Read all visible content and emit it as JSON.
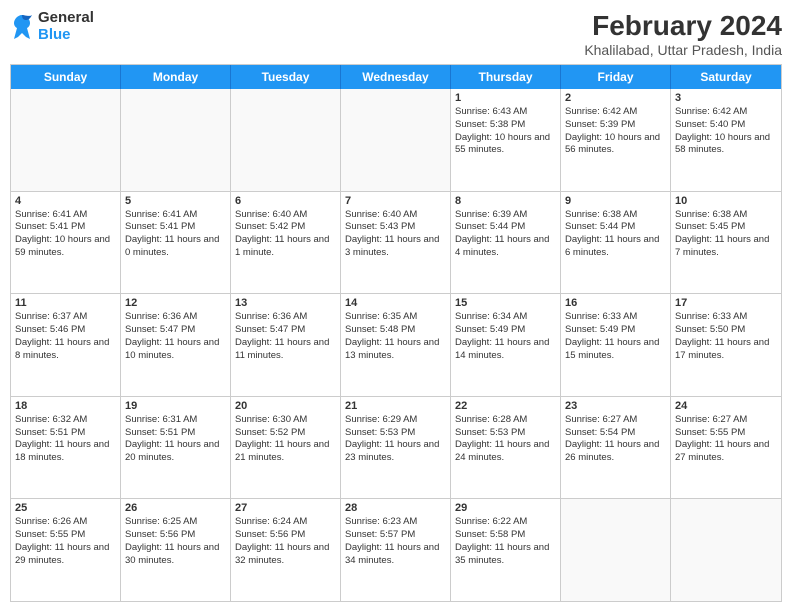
{
  "header": {
    "logo": {
      "general": "General",
      "blue": "Blue"
    },
    "month_year": "February 2024",
    "location": "Khalilabad, Uttar Pradesh, India"
  },
  "weekdays": [
    "Sunday",
    "Monday",
    "Tuesday",
    "Wednesday",
    "Thursday",
    "Friday",
    "Saturday"
  ],
  "rows": [
    [
      {
        "day": "",
        "empty": true
      },
      {
        "day": "",
        "empty": true
      },
      {
        "day": "",
        "empty": true
      },
      {
        "day": "",
        "empty": true
      },
      {
        "day": "1",
        "sunrise": "Sunrise: 6:43 AM",
        "sunset": "Sunset: 5:38 PM",
        "daylight": "Daylight: 10 hours and 55 minutes."
      },
      {
        "day": "2",
        "sunrise": "Sunrise: 6:42 AM",
        "sunset": "Sunset: 5:39 PM",
        "daylight": "Daylight: 10 hours and 56 minutes."
      },
      {
        "day": "3",
        "sunrise": "Sunrise: 6:42 AM",
        "sunset": "Sunset: 5:40 PM",
        "daylight": "Daylight: 10 hours and 58 minutes."
      }
    ],
    [
      {
        "day": "4",
        "sunrise": "Sunrise: 6:41 AM",
        "sunset": "Sunset: 5:41 PM",
        "daylight": "Daylight: 10 hours and 59 minutes."
      },
      {
        "day": "5",
        "sunrise": "Sunrise: 6:41 AM",
        "sunset": "Sunset: 5:41 PM",
        "daylight": "Daylight: 11 hours and 0 minutes."
      },
      {
        "day": "6",
        "sunrise": "Sunrise: 6:40 AM",
        "sunset": "Sunset: 5:42 PM",
        "daylight": "Daylight: 11 hours and 1 minute."
      },
      {
        "day": "7",
        "sunrise": "Sunrise: 6:40 AM",
        "sunset": "Sunset: 5:43 PM",
        "daylight": "Daylight: 11 hours and 3 minutes."
      },
      {
        "day": "8",
        "sunrise": "Sunrise: 6:39 AM",
        "sunset": "Sunset: 5:44 PM",
        "daylight": "Daylight: 11 hours and 4 minutes."
      },
      {
        "day": "9",
        "sunrise": "Sunrise: 6:38 AM",
        "sunset": "Sunset: 5:44 PM",
        "daylight": "Daylight: 11 hours and 6 minutes."
      },
      {
        "day": "10",
        "sunrise": "Sunrise: 6:38 AM",
        "sunset": "Sunset: 5:45 PM",
        "daylight": "Daylight: 11 hours and 7 minutes."
      }
    ],
    [
      {
        "day": "11",
        "sunrise": "Sunrise: 6:37 AM",
        "sunset": "Sunset: 5:46 PM",
        "daylight": "Daylight: 11 hours and 8 minutes."
      },
      {
        "day": "12",
        "sunrise": "Sunrise: 6:36 AM",
        "sunset": "Sunset: 5:47 PM",
        "daylight": "Daylight: 11 hours and 10 minutes."
      },
      {
        "day": "13",
        "sunrise": "Sunrise: 6:36 AM",
        "sunset": "Sunset: 5:47 PM",
        "daylight": "Daylight: 11 hours and 11 minutes."
      },
      {
        "day": "14",
        "sunrise": "Sunrise: 6:35 AM",
        "sunset": "Sunset: 5:48 PM",
        "daylight": "Daylight: 11 hours and 13 minutes."
      },
      {
        "day": "15",
        "sunrise": "Sunrise: 6:34 AM",
        "sunset": "Sunset: 5:49 PM",
        "daylight": "Daylight: 11 hours and 14 minutes."
      },
      {
        "day": "16",
        "sunrise": "Sunrise: 6:33 AM",
        "sunset": "Sunset: 5:49 PM",
        "daylight": "Daylight: 11 hours and 15 minutes."
      },
      {
        "day": "17",
        "sunrise": "Sunrise: 6:33 AM",
        "sunset": "Sunset: 5:50 PM",
        "daylight": "Daylight: 11 hours and 17 minutes."
      }
    ],
    [
      {
        "day": "18",
        "sunrise": "Sunrise: 6:32 AM",
        "sunset": "Sunset: 5:51 PM",
        "daylight": "Daylight: 11 hours and 18 minutes."
      },
      {
        "day": "19",
        "sunrise": "Sunrise: 6:31 AM",
        "sunset": "Sunset: 5:51 PM",
        "daylight": "Daylight: 11 hours and 20 minutes."
      },
      {
        "day": "20",
        "sunrise": "Sunrise: 6:30 AM",
        "sunset": "Sunset: 5:52 PM",
        "daylight": "Daylight: 11 hours and 21 minutes."
      },
      {
        "day": "21",
        "sunrise": "Sunrise: 6:29 AM",
        "sunset": "Sunset: 5:53 PM",
        "daylight": "Daylight: 11 hours and 23 minutes."
      },
      {
        "day": "22",
        "sunrise": "Sunrise: 6:28 AM",
        "sunset": "Sunset: 5:53 PM",
        "daylight": "Daylight: 11 hours and 24 minutes."
      },
      {
        "day": "23",
        "sunrise": "Sunrise: 6:27 AM",
        "sunset": "Sunset: 5:54 PM",
        "daylight": "Daylight: 11 hours and 26 minutes."
      },
      {
        "day": "24",
        "sunrise": "Sunrise: 6:27 AM",
        "sunset": "Sunset: 5:55 PM",
        "daylight": "Daylight: 11 hours and 27 minutes."
      }
    ],
    [
      {
        "day": "25",
        "sunrise": "Sunrise: 6:26 AM",
        "sunset": "Sunset: 5:55 PM",
        "daylight": "Daylight: 11 hours and 29 minutes."
      },
      {
        "day": "26",
        "sunrise": "Sunrise: 6:25 AM",
        "sunset": "Sunset: 5:56 PM",
        "daylight": "Daylight: 11 hours and 30 minutes."
      },
      {
        "day": "27",
        "sunrise": "Sunrise: 6:24 AM",
        "sunset": "Sunset: 5:56 PM",
        "daylight": "Daylight: 11 hours and 32 minutes."
      },
      {
        "day": "28",
        "sunrise": "Sunrise: 6:23 AM",
        "sunset": "Sunset: 5:57 PM",
        "daylight": "Daylight: 11 hours and 34 minutes."
      },
      {
        "day": "29",
        "sunrise": "Sunrise: 6:22 AM",
        "sunset": "Sunset: 5:58 PM",
        "daylight": "Daylight: 11 hours and 35 minutes."
      },
      {
        "day": "",
        "empty": true
      },
      {
        "day": "",
        "empty": true
      }
    ]
  ]
}
